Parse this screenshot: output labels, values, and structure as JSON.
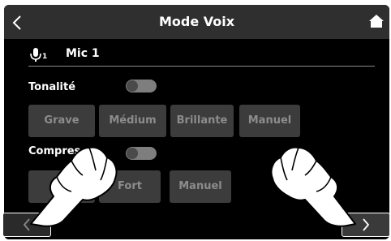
{
  "header": {
    "title": "Mode Voix",
    "back_icon": "chevron-left-icon",
    "home_icon": "home-icon"
  },
  "channel": {
    "icon": "microphone-icon",
    "index": "1",
    "name": "Mic 1"
  },
  "tone": {
    "label": "Tonalité",
    "enabled": false,
    "options": [
      "Grave",
      "Médium",
      "Brillante",
      "Manuel"
    ]
  },
  "compressor": {
    "label": "Compres",
    "enabled": false,
    "options": [
      "Fort",
      "Manuel"
    ]
  },
  "nav": {
    "prev_icon": "chevron-left-icon",
    "next_icon": "chevron-right-icon"
  },
  "colors": {
    "background": "#000000",
    "header": "#2f2f2f",
    "button": "#3c3c3c",
    "button_text": "#8c8c8c",
    "toggle_off": "#7e7e7e"
  }
}
